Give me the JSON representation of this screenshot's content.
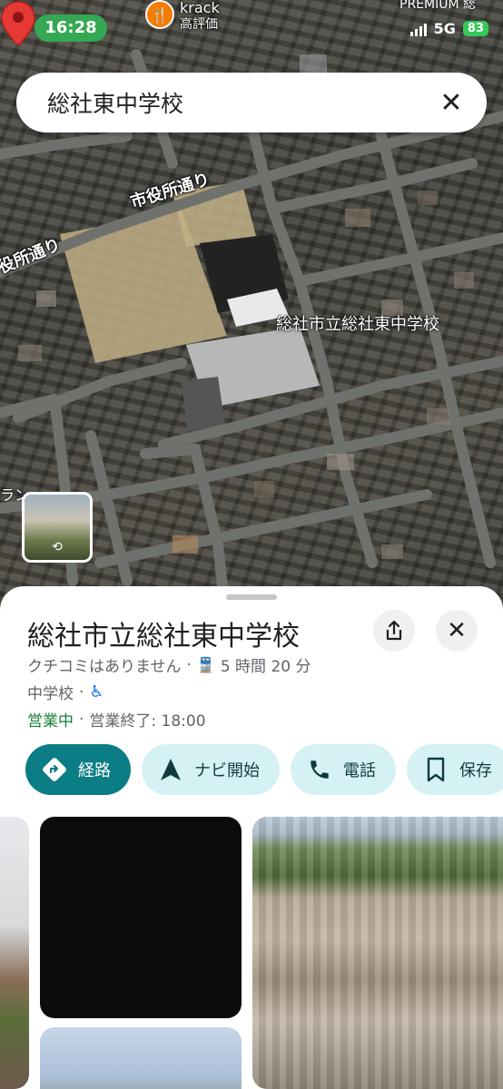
{
  "status_bar": {
    "time": "16:28",
    "network": "5G",
    "battery": "83"
  },
  "map": {
    "top_poi": {
      "name": "krack",
      "subtitle": "高評価"
    },
    "top_right_label": "PREMIUM 総",
    "search": {
      "query": "総社東中学校"
    },
    "roads": [
      "市役所通り",
      "役所通り"
    ],
    "edge_label": "ラン",
    "school_label": "総社市立総社東中学校"
  },
  "place": {
    "title": "総社市立総社東中学校",
    "reviews": "クチコミはありません",
    "transit_time": "5 時間 20 分",
    "category": "中学校",
    "open_status": "営業中",
    "closing": "営業終了: 18:00"
  },
  "actions": [
    {
      "label": "経路",
      "icon": "directions-icon"
    },
    {
      "label": "ナビ開始",
      "icon": "navigation-icon"
    },
    {
      "label": "電話",
      "icon": "phone-icon"
    },
    {
      "label": "保存",
      "icon": "bookmark-icon"
    }
  ],
  "colors": {
    "primary": "#0b7d84",
    "secondary": "#d6f1f3",
    "open": "#188038",
    "pin": "#e53935",
    "time_badge": "#34a853"
  }
}
